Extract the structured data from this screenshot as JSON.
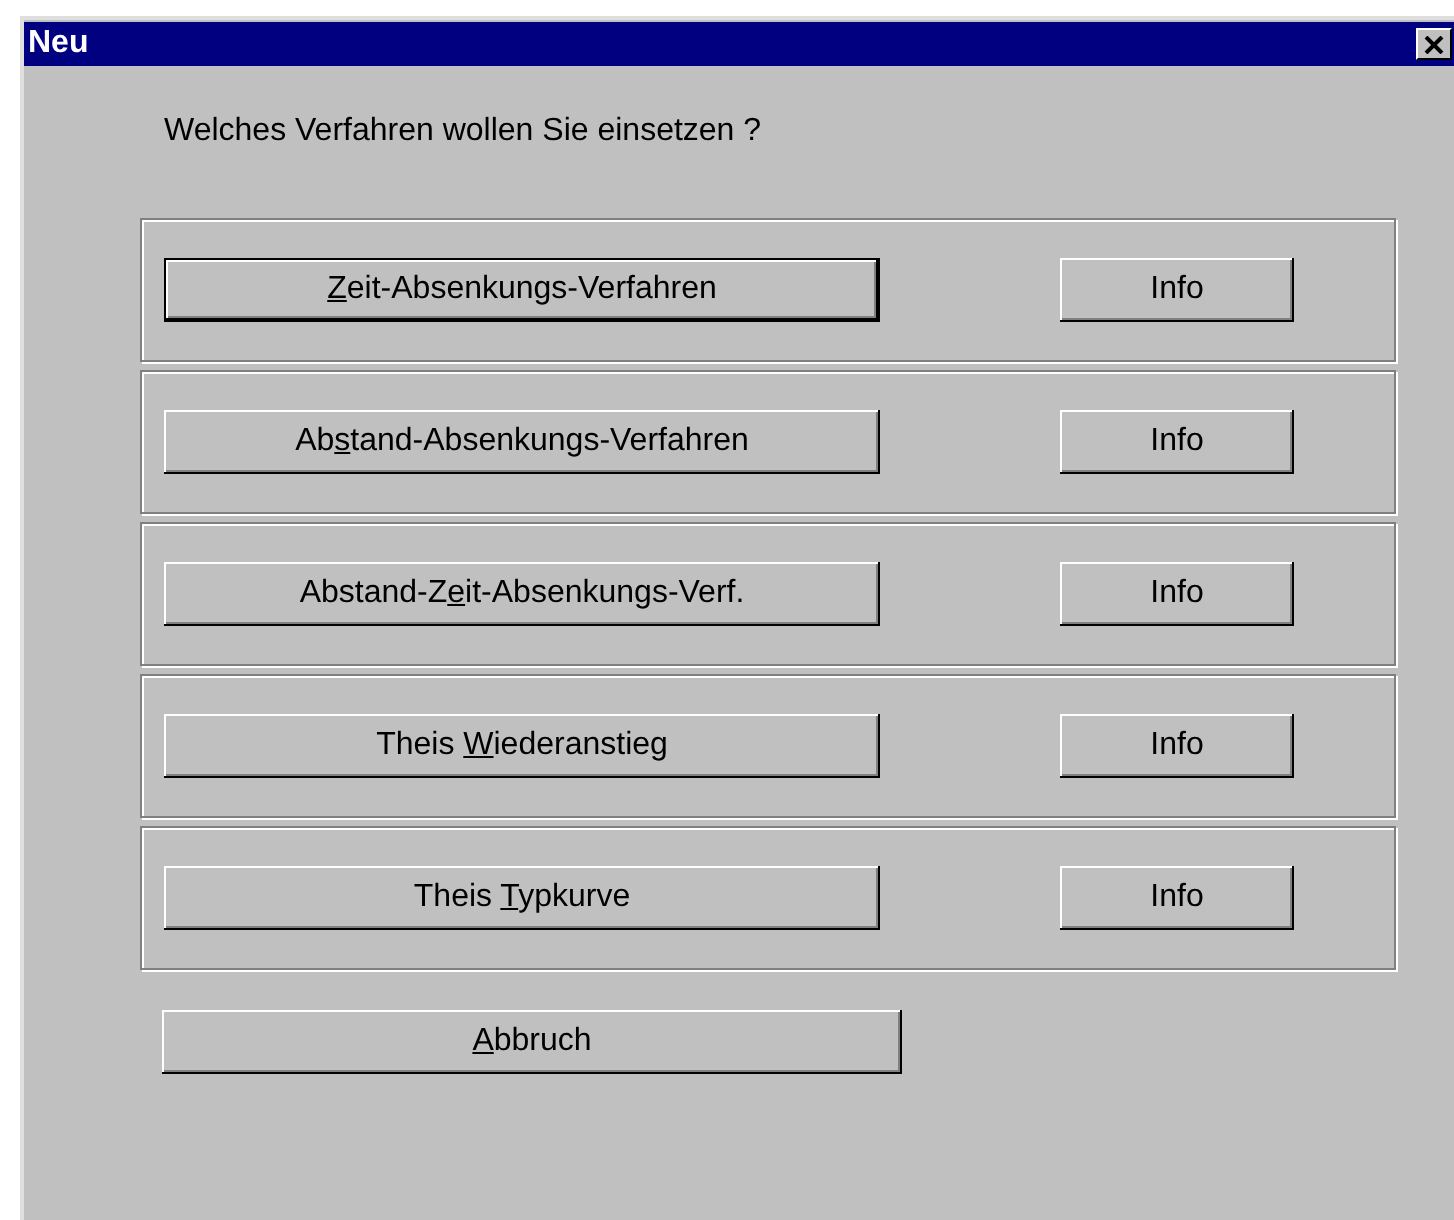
{
  "window": {
    "title": "Neu"
  },
  "prompt": "Welches Verfahren wollen Sie einsetzen ?",
  "methods": [
    {
      "label": {
        "key": "Z",
        "after": "eit-Absenkungs-Verfahren"
      },
      "default": true,
      "info": "Info"
    },
    {
      "label": {
        "before": "Ab",
        "key": "s",
        "after": "tand-Absenkungs-Verfahren"
      },
      "default": false,
      "info": "Info"
    },
    {
      "label": {
        "before": "Abstand-Z",
        "key": "e",
        "after": "it-Absenkungs-Verf."
      },
      "default": false,
      "info": "Info"
    },
    {
      "label": {
        "before": "Theis ",
        "key": "W",
        "after": "iederanstieg"
      },
      "default": false,
      "info": "Info"
    },
    {
      "label": {
        "before": "Theis ",
        "key": "T",
        "after": "ypkurve"
      },
      "default": false,
      "info": "Info"
    }
  ],
  "cancel": {
    "key": "A",
    "after": "bbruch"
  }
}
